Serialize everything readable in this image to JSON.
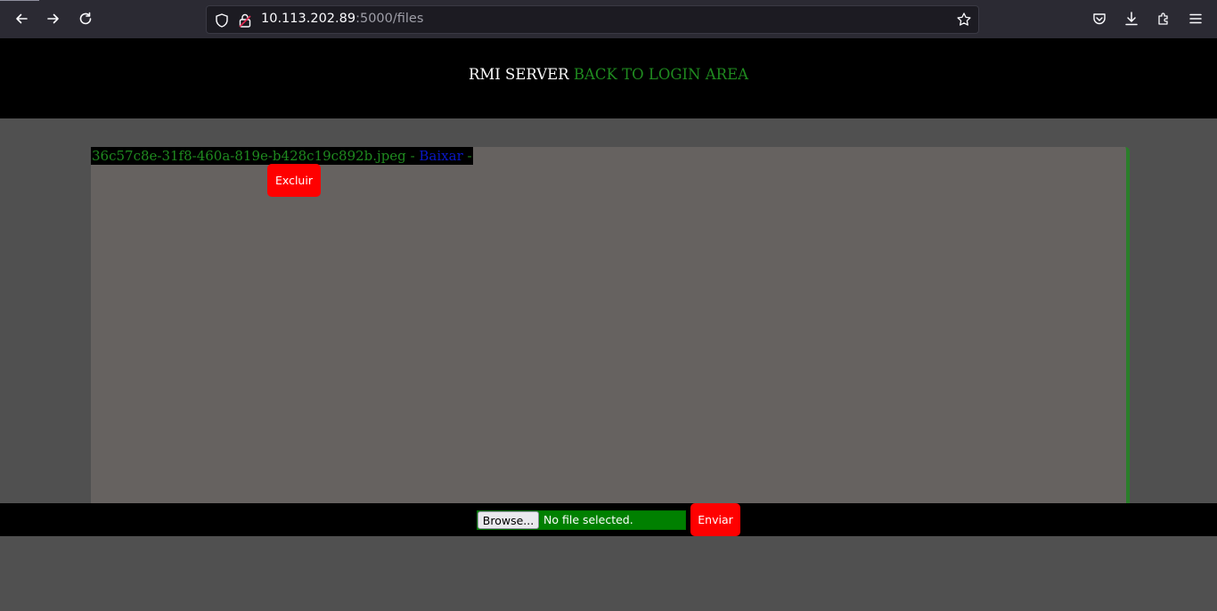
{
  "browser": {
    "url_host": "10.113.202.89",
    "url_rest": ":5000/files",
    "icons": [
      "back-icon",
      "forward-icon",
      "reload-icon",
      "shield-icon",
      "lock-icon",
      "bookmark-star-icon",
      "pocket-icon",
      "download-icon",
      "extensions-icon",
      "menu-icon"
    ]
  },
  "header": {
    "title": "RMI SERVER",
    "login_link": "BACK TO LOGIN AREA"
  },
  "files": [
    {
      "name": "36c57c8e-31f8-460a-819e-b428c19c892b.jpeg",
      "separator": " - ",
      "download_label": "Baixar",
      "trailing": " -",
      "delete_label": "Excluir"
    }
  ],
  "upload": {
    "browse_label": "Browse...",
    "status": "No file selected.",
    "send_label": "Enviar"
  },
  "colors": {
    "header_bg": "#000000",
    "link_green": "#1f8a1f",
    "download_blue": "#0a18c8",
    "button_red": "#ff0000",
    "panel_bg": "#666260",
    "page_bg": "#505050"
  }
}
